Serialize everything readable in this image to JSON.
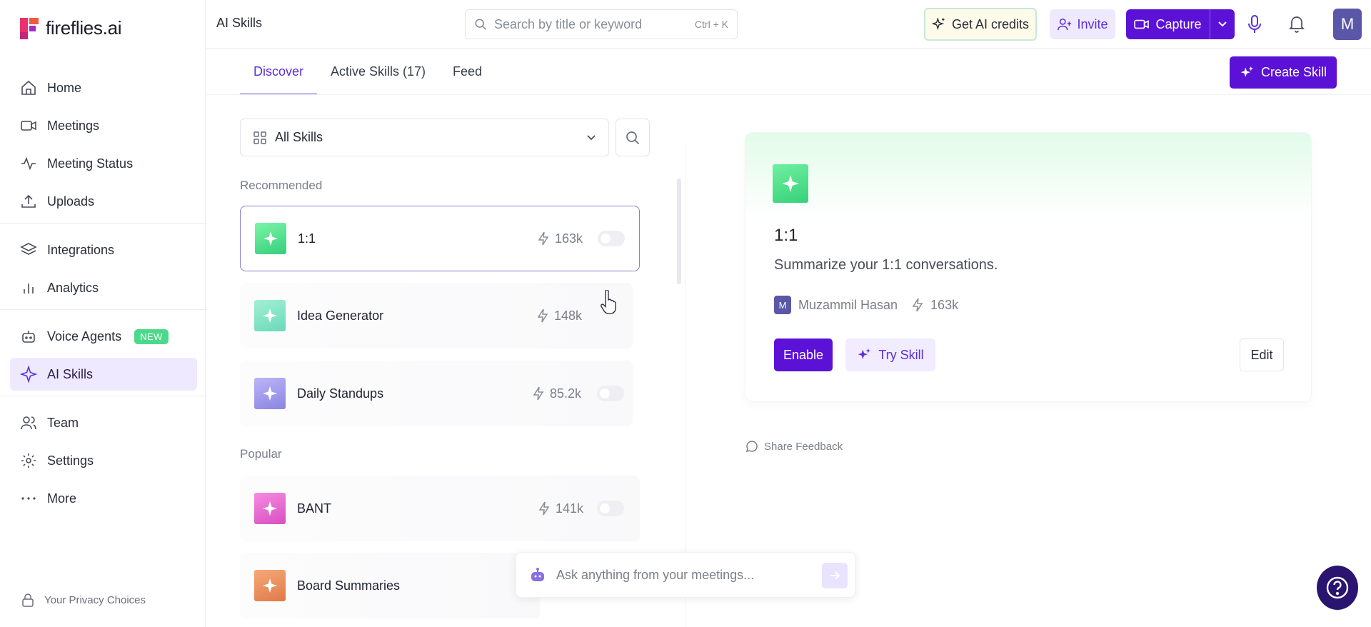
{
  "app": {
    "logo_text": "fireflies.ai",
    "page_title": "AI Skills"
  },
  "sidebar": {
    "items": [
      {
        "label": "Home",
        "icon": "home-icon"
      },
      {
        "label": "Meetings",
        "icon": "video-icon"
      },
      {
        "label": "Meeting Status",
        "icon": "pulse-icon"
      },
      {
        "label": "Uploads",
        "icon": "upload-icon"
      },
      {
        "label": "Integrations",
        "icon": "layers-icon"
      },
      {
        "label": "Analytics",
        "icon": "bar-chart-icon"
      },
      {
        "label": "Voice Agents",
        "icon": "robot-icon",
        "badge": "NEW"
      },
      {
        "label": "AI Skills",
        "icon": "sparkle-icon",
        "active": true
      },
      {
        "label": "Team",
        "icon": "users-icon"
      },
      {
        "label": "Settings",
        "icon": "gear-icon"
      },
      {
        "label": "More",
        "icon": "more-icon"
      }
    ],
    "privacy": "Your Privacy Choices"
  },
  "topbar": {
    "search_placeholder": "Search by title or keyword",
    "search_shortcut": "Ctrl + K",
    "credits_label": "Get AI credits",
    "invite_label": "Invite",
    "capture_label": "Capture",
    "avatar_initial": "M"
  },
  "tabs": [
    {
      "label": "Discover",
      "active": true
    },
    {
      "label": "Active Skills  (17)"
    },
    {
      "label": "Feed"
    }
  ],
  "create_skill_label": "Create Skill",
  "filter": {
    "label": "All Skills"
  },
  "sections": {
    "recommended": "Recommended",
    "popular": "Popular"
  },
  "skills": {
    "recommended": [
      {
        "name": "1:1",
        "count": "163k",
        "color_top": "#7df5a8",
        "color_bottom": "#34cf7a",
        "selected": true
      },
      {
        "name": "Idea Generator",
        "count": "148k",
        "color_top": "#a3f0d4",
        "color_bottom": "#6ad9b8"
      },
      {
        "name": "Daily Standups",
        "count": "85.2k",
        "color_top": "#bcb6f5",
        "color_bottom": "#8b84e3"
      }
    ],
    "popular": [
      {
        "name": "BANT",
        "count": "141k",
        "color_top": "#f58ce0",
        "color_bottom": "#d94fc1"
      },
      {
        "name": "Board Summaries",
        "count": "",
        "color_top": "#f5a97a",
        "color_bottom": "#e07a48"
      }
    ]
  },
  "detail": {
    "title": "1:1",
    "description": "Summarize your 1:1 conversations.",
    "author_initial": "M",
    "author": "Muzammil Hasan",
    "count": "163k",
    "enable_label": "Enable",
    "try_label": "Try Skill",
    "edit_label": "Edit"
  },
  "share_feedback": "Share Feedback",
  "ask_placeholder": "Ask anything from your meetings...",
  "colors": {
    "brand": "#5b12d6",
    "accent_light": "#efe9ff",
    "new_badge": "#4cd98a"
  }
}
